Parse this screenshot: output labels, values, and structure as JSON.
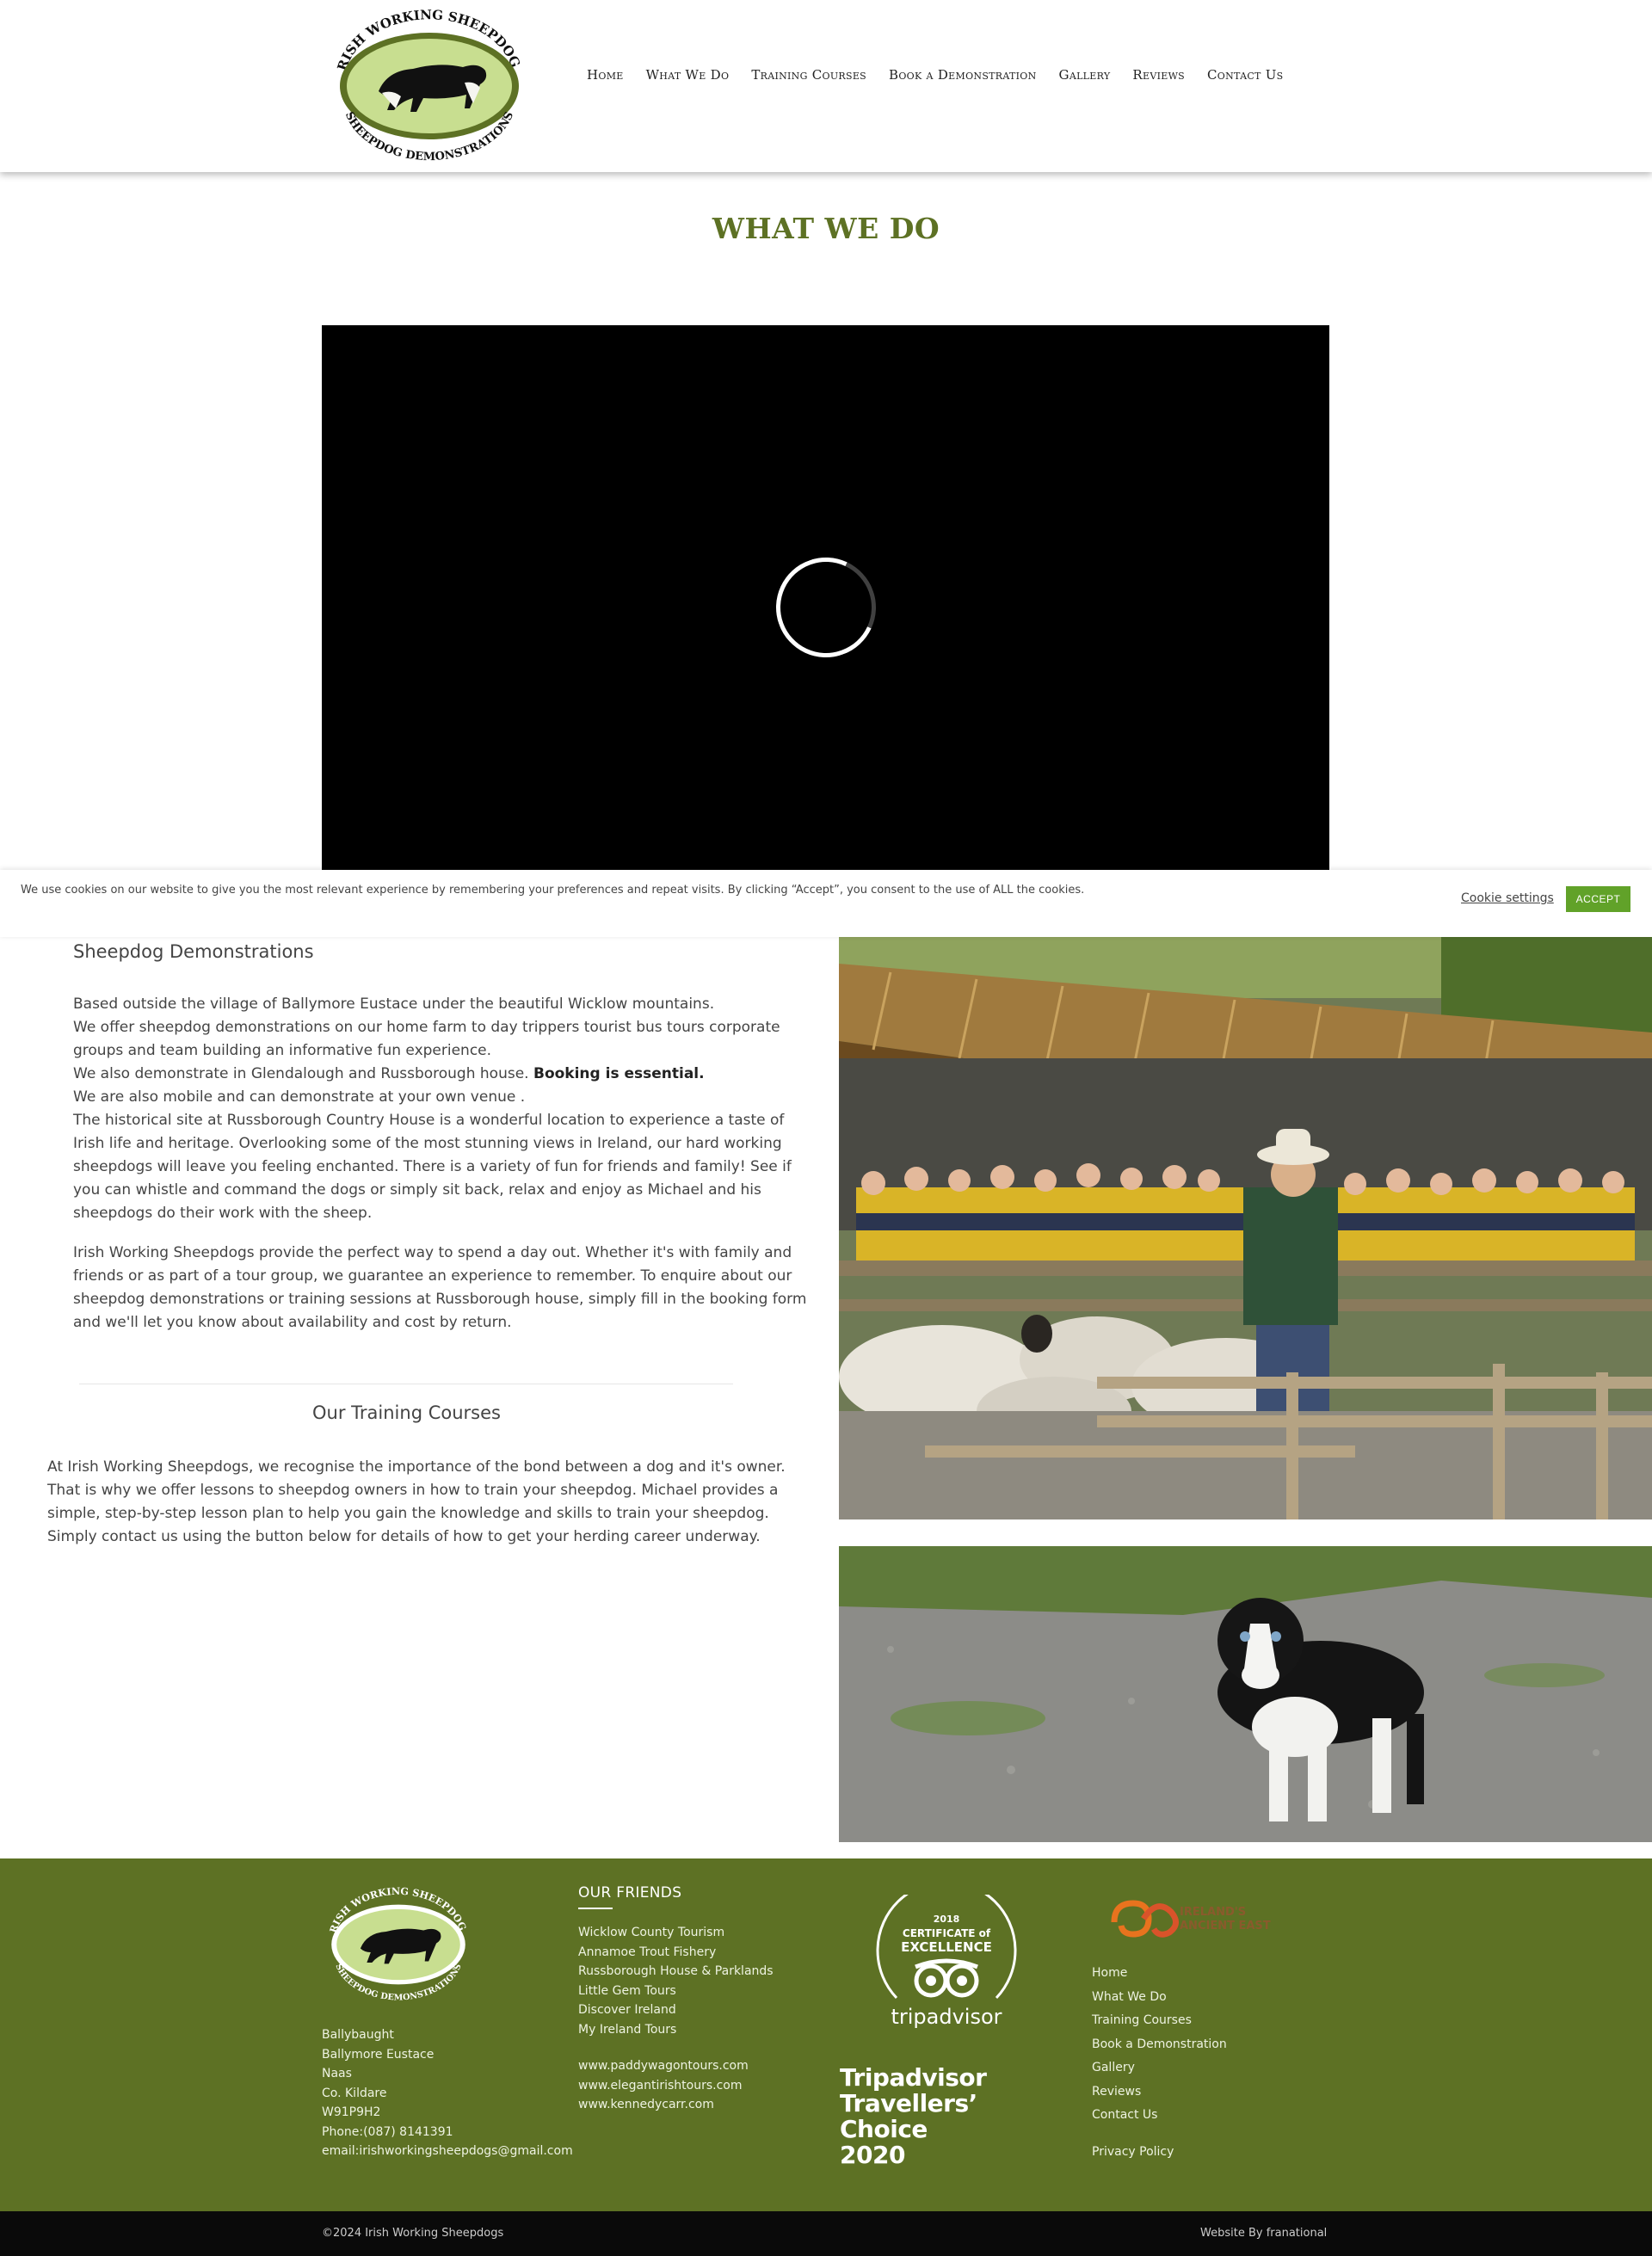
{
  "header": {
    "logo": {
      "top_text": "IRISH WORKING SHEEPDOGS",
      "bottom_text": "SHEEPDOG DEMONSTRATIONS"
    },
    "nav": [
      "Home",
      "What We Do",
      "Training Courses",
      "Book a Demonstration",
      "Gallery",
      "Reviews",
      "Contact Us"
    ]
  },
  "page": {
    "title": "WHAT WE DO"
  },
  "cookie": {
    "text": "We use cookies on our website to give you the most relevant experience by remembering your preferences and repeat visits. By clicking “Accept”, you consent to the use of ALL the cookies.",
    "settings_label": "Cookie settings",
    "accept_label": "ACCEPT"
  },
  "demos": {
    "heading": "Sheepdog Demonstrations",
    "lines": [
      "Based outside the village of Ballymore Eustace under the beautiful Wicklow mountains.",
      "We offer sheepdog demonstrations on our home farm to day trippers tourist bus tours corporate groups and team building an  informative fun experience.",
      "We also demonstrate in Glendalough and Russborough house. ",
      "Booking is essential.",
      "We are also mobile and can demonstrate at your own venue .",
      "The historical site at Russborough Country House is a wonderful location to experience a taste of Irish life and heritage. Overlooking some of the most stunning views in Ireland, our hard working sheepdogs will leave you feeling enchanted. There is a variety of fun for friends and family! See if you can whistle and command the dogs or simply sit back, relax and enjoy as Michael and his sheepdogs do their work with the sheep."
    ],
    "para2": "Irish Working Sheepdogs provide the perfect way to spend a day out. Whether it's with family and friends or as part of a tour group, we guarantee an experience to remember. To enquire about our sheepdog demonstrations or training sessions at Russborough house, simply fill in the booking form and we'll let you know about availability and cost by return."
  },
  "training": {
    "heading": "Our Training Courses",
    "para": "At Irish Working Sheepdogs, we recognise the importance of the bond between a dog and it's owner. That is why we offer lessons to sheepdog owners in how to train your sheepdog. Michael provides a simple, step-by-step lesson plan to help you gain the knowledge and skills to train your sheepdog. Simply contact us using the button below for details of how to get your herding career underway."
  },
  "footer": {
    "address": [
      "Ballybaught",
      "Ballymore Eustace",
      "Naas",
      "Co. Kildare",
      "W91P9H2",
      "Phone:(087) 8141391",
      "email:irishworkingsheepdogs@gmail.com"
    ],
    "friends_heading": "OUR FRIENDS",
    "friends": [
      "Wicklow County Tourism",
      "Annamoe Trout Fishery",
      "Russborough House & Parklands",
      "Little Gem Tours",
      "Discover Ireland",
      "My Ireland Tours"
    ],
    "friend_sites": [
      "www.paddywagontours.com",
      "www.elegantirishtours.com",
      "www.kennedycarr.com"
    ],
    "tripadvisor": {
      "year": "2018",
      "line1": "CERTIFICATE of",
      "line2": "EXCELLENCE",
      "brand": "tripadvisor"
    },
    "travellers_choice": [
      "Tripadvisor",
      "Travellers’",
      "Choice",
      "2020"
    ],
    "ancient_east": [
      "IRELAND'S",
      "ANCIENT EAST"
    ],
    "nav": [
      "Home",
      "What We Do",
      "Training Courses",
      "Book a Demonstration",
      "Gallery",
      "Reviews",
      "Contact Us"
    ],
    "privacy": "Privacy Policy"
  },
  "bottom": {
    "copyright": "©2024 Irish Working Sheepdogs",
    "credit": "Website By franational"
  },
  "colors": {
    "brand_green": "#5d7124",
    "accept_green": "#61a229",
    "logo_green": "#c8de90"
  }
}
